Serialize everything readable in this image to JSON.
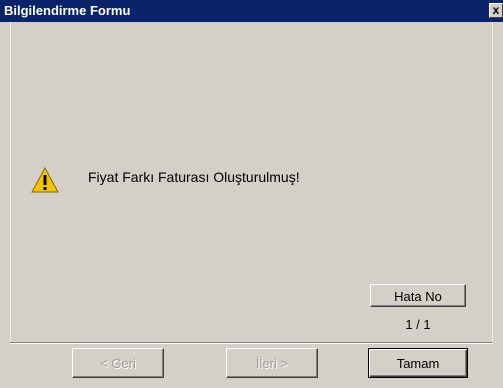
{
  "window": {
    "title": "Bilgilendirme Formu",
    "close_label": "x"
  },
  "dialog": {
    "icon": "warning-icon",
    "message": "Fiyat Farkı Faturası Oluşturulmuş!"
  },
  "error_nav": {
    "hata_no_label": "Hata No",
    "page_count": "1 / 1"
  },
  "buttons": {
    "back_label": "< Geri",
    "next_label": "İleri >",
    "ok_label": "Tamam"
  },
  "colors": {
    "titlebar": "#0a246a",
    "face": "#d4d0c8",
    "warning": "#f5c400"
  }
}
